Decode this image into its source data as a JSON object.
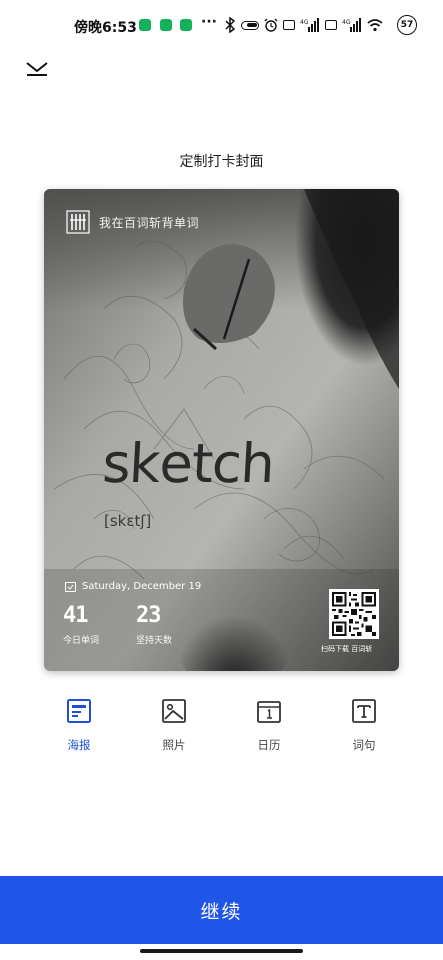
{
  "status_bar": {
    "time": "傍晚6:53",
    "more": "···",
    "battery": "57"
  },
  "header": {
    "close_icon": "chevron-collapse-icon",
    "title": "定制打卡封面"
  },
  "poster": {
    "brand_text": "我在百词斩背单词",
    "word": "sketch",
    "phonetic": "[skɛtʃ]",
    "date": "Saturday, December 19",
    "stats": [
      {
        "value": "41",
        "label": "今日单词"
      },
      {
        "value": "23",
        "label": "坚持天数"
      }
    ],
    "qr_caption": "扫码下载 百词斩"
  },
  "tabs": [
    {
      "label": "海报",
      "icon": "poster-icon",
      "active": true
    },
    {
      "label": "照片",
      "icon": "photo-icon",
      "active": false
    },
    {
      "label": "日历",
      "icon": "calendar-icon",
      "active": false
    },
    {
      "label": "词句",
      "icon": "text-icon",
      "active": false
    }
  ],
  "actions": {
    "continue_label": "继续"
  },
  "colors": {
    "accent": "#1f56e8",
    "active_tab": "#1e4fd6",
    "inactive_tab": "#444444"
  }
}
